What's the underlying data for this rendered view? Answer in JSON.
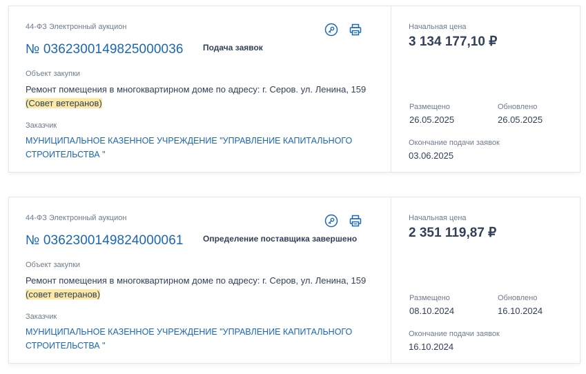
{
  "colors": {
    "accent": "#1a66b6",
    "text": "#334059",
    "muted": "#6d7a8c",
    "highlight": "#fbe9a5",
    "border": "#e3e6ea"
  },
  "icons": [
    "key-icon",
    "printer-icon"
  ],
  "cards": [
    {
      "law_type": "44-ФЗ Электронный аукцион",
      "number": "№ 0362300149825000036",
      "status": "Подача заявок",
      "object_label": "Объект закупки",
      "object_text": "Ремонт помещения в многоквартирном доме по адресу: г. Серов. ул. Ленина, 159",
      "object_highlight": "(Совет ветеранов)",
      "customer_label": "Заказчик",
      "customer_name": "МУНИЦИПАЛЬНОЕ КАЗЕННОЕ УЧРЕЖДЕНИЕ \"УПРАВЛЕНИЕ КАПИТАЛЬНОГО СТРОИТЕЛЬСТВА \"",
      "price_label": "Начальная цена",
      "price": "3 134 177,10 ₽",
      "posted_label": "Размещено",
      "posted_date": "26.05.2025",
      "updated_label": "Обновлено",
      "updated_date": "26.05.2025",
      "deadline_label": "Окончание подачи заявок",
      "deadline_date": "03.06.2025"
    },
    {
      "law_type": "44-ФЗ Электронный аукцион",
      "number": "№ 0362300149824000061",
      "status": "Определение поставщика завершено",
      "object_label": "Объект закупки",
      "object_text": "Ремонт помещения в многоквартирном доме по адресу: г. Серов, ул. Ленина, 159",
      "object_highlight": "(совет ветеранов)",
      "customer_label": "Заказчик",
      "customer_name": "МУНИЦИПАЛЬНОЕ КАЗЕННОЕ УЧРЕЖДЕНИЕ \"УПРАВЛЕНИЕ КАПИТАЛЬНОГО СТРОИТЕЛЬСТВА \"",
      "price_label": "Начальная цена",
      "price": "2 351 119,87 ₽",
      "posted_label": "Размещено",
      "posted_date": "08.10.2024",
      "updated_label": "Обновлено",
      "updated_date": "16.10.2024",
      "deadline_label": "Окончание подачи заявок",
      "deadline_date": "16.10.2024"
    }
  ]
}
